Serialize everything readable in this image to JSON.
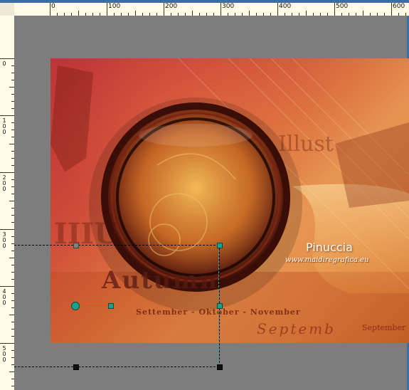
{
  "ruler_horizontal": {
    "labels": [
      "0",
      "100",
      "200",
      "300",
      "400",
      "500",
      "600"
    ]
  },
  "ruler_vertical": {
    "labels": [
      "0",
      "100",
      "200",
      "300",
      "400",
      "500"
    ]
  },
  "watermark": {
    "name": "Pinuccia",
    "site": "www.maidiregrafica.eu"
  },
  "artwork_text": {
    "months_line": "Settember - Oktober - November",
    "septemb": "Septemb",
    "september_right": "September",
    "autumn": "Autumn"
  },
  "colors": {
    "workspace": "#7d7d7d",
    "ruler_bg": "#fffbe6",
    "accent_blue": "#3a6ea5",
    "handle_teal": "#1aa38c"
  },
  "icons": [
    "rotation-handle-icon",
    "pick-tool-handle-icon"
  ]
}
